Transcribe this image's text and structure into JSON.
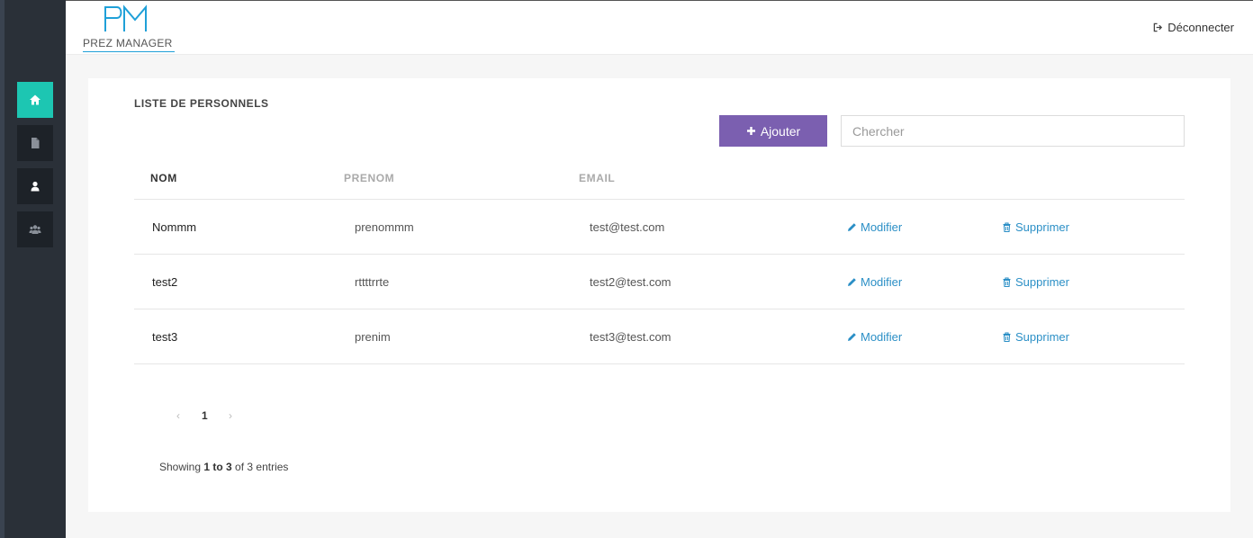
{
  "app": {
    "logo_text": "PREZ MANAGER",
    "logout_label": "Déconnecter"
  },
  "sidebar": {
    "items": [
      {
        "icon": "home-icon",
        "active": true
      },
      {
        "icon": "file-icon",
        "active": false
      },
      {
        "icon": "user-icon",
        "active": false
      },
      {
        "icon": "users-icon",
        "active": false
      }
    ]
  },
  "page": {
    "title": "LISTE DE PERSONNELS",
    "add_label": "Ajouter",
    "search_placeholder": "Chercher"
  },
  "table": {
    "headers": {
      "nom": "NOM",
      "prenom": "PRENOM",
      "email": "EMAIL"
    },
    "modify_label": "Modifier",
    "delete_label": "Supprimer",
    "rows": [
      {
        "nom": "Nommm",
        "prenom": "prenommm",
        "email": "test@test.com"
      },
      {
        "nom": "test2",
        "prenom": "rttttrrte",
        "email": "test2@test.com"
      },
      {
        "nom": "test3",
        "prenom": "prenim",
        "email": "test3@test.com"
      }
    ]
  },
  "pagination": {
    "prev": "‹",
    "current": "1",
    "next": "›"
  },
  "info": {
    "prefix": "Showing ",
    "range": "1 to 3",
    "suffix": " of 3 entries"
  },
  "colors": {
    "accent": "#1dc6b2",
    "button": "#7b5fb0",
    "link": "#2b8fc6",
    "sidebar": "#2a3038"
  }
}
